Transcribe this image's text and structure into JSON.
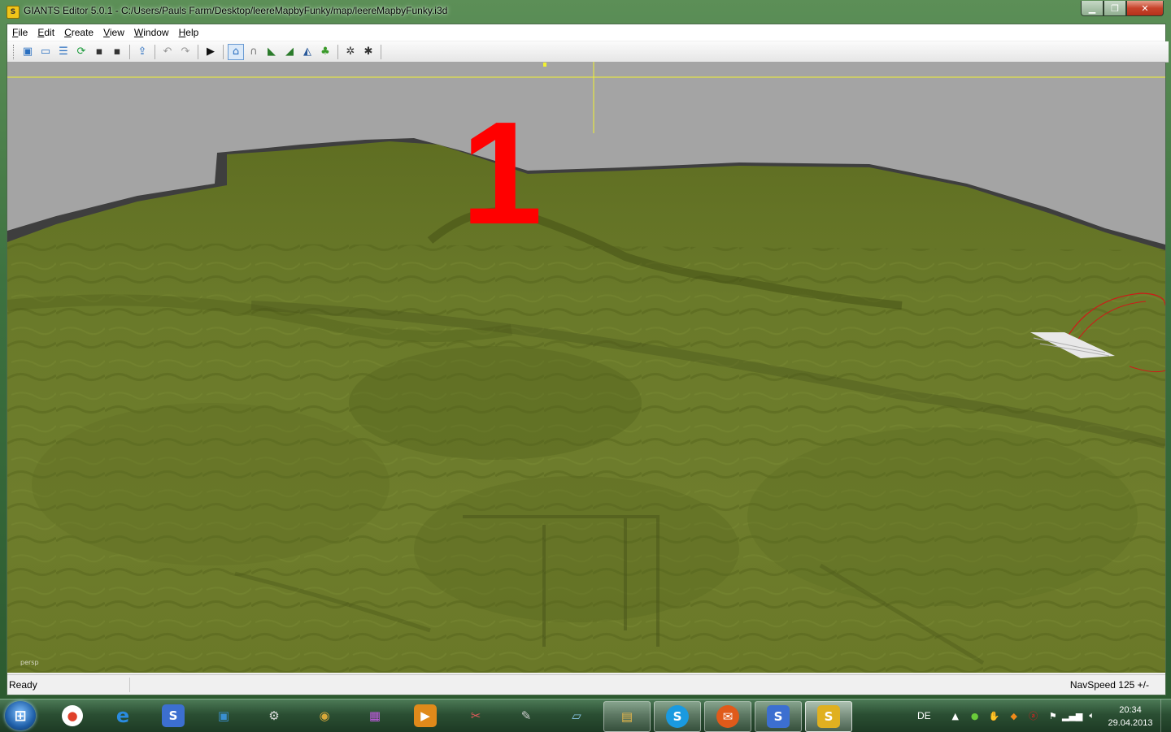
{
  "window": {
    "title": "GIANTS Editor 5.0.1 - C:/Users/Pauls Farm/Desktop/leereMapbyFunky/map/leereMapbyFunky.i3d",
    "app_icon": "S",
    "buttons": {
      "minimize": "minimize-icon",
      "maximize": "maximize-icon",
      "close": "close-icon"
    }
  },
  "menu": {
    "items": [
      {
        "first": "F",
        "rest": "ile"
      },
      {
        "first": "E",
        "rest": "dit"
      },
      {
        "first": "C",
        "rest": "reate"
      },
      {
        "first": "V",
        "rest": "iew"
      },
      {
        "first": "W",
        "rest": "indow"
      },
      {
        "first": "H",
        "rest": "elp"
      }
    ]
  },
  "toolbar": {
    "groups": [
      [
        "new-scene-icon",
        "open-icon",
        "properties-icon",
        "reload-icon",
        "save-icon",
        "save-as-icon"
      ],
      [
        "import-icon"
      ],
      [
        "undo-icon",
        "redo-icon"
      ],
      [
        "play-icon"
      ],
      [
        "select-mode-icon",
        "move-mode-icon",
        "terrain-sculpt-icon",
        "terrain-paint-icon",
        "foliage-paint-icon",
        "grass-paint-icon"
      ],
      [
        "navigate-mode-icon",
        "snap-icon"
      ]
    ]
  },
  "viewport": {
    "overlay_text": "1",
    "camera_label": "persp",
    "colors": {
      "sky": "#a4a4a4",
      "terrain": "#6b7a2a",
      "overlay_text": "#ff0000",
      "guide": "#ffff33"
    }
  },
  "status": {
    "left": "Ready",
    "right": "NavSpeed 125 +/-"
  },
  "taskbar": {
    "start": "windows-start-icon",
    "apps": [
      {
        "name": "chrome-icon",
        "glyph": "●",
        "color": "#e0402a"
      },
      {
        "name": "internet-explorer-icon",
        "glyph": "e",
        "color": "#2a8be0"
      },
      {
        "name": "giants-editor-icon",
        "glyph": "S",
        "color": "#3c6fd0"
      },
      {
        "name": "computer-icon",
        "glyph": "▣",
        "color": "#3a8fd0"
      },
      {
        "name": "settings-icon",
        "glyph": "⚙",
        "color": "#666"
      },
      {
        "name": "dvd-icon",
        "glyph": "◉",
        "color": "#b88a2a"
      },
      {
        "name": "archive-icon",
        "glyph": "▦",
        "color": "#8a3aa8"
      },
      {
        "name": "media-player-icon",
        "glyph": "▶",
        "color": "#e08a1a"
      },
      {
        "name": "snipping-tool-icon",
        "glyph": "✂",
        "color": "#c23a3a"
      },
      {
        "name": "gimp-icon",
        "glyph": "✎",
        "color": "#555"
      },
      {
        "name": "notepad-icon",
        "glyph": "▱",
        "color": "#5aa0c8"
      },
      {
        "name": "explorer-icon",
        "glyph": "▤",
        "color": "#d8a83a"
      },
      {
        "name": "skype-icon",
        "glyph": "S",
        "color": "#1a9ae0"
      },
      {
        "name": "mail-icon",
        "glyph": "✉",
        "color": "#e05a1a"
      },
      {
        "name": "giants-editor-icon-2",
        "glyph": "S",
        "color": "#3c6fd0"
      },
      {
        "name": "giants-editor-active-icon",
        "glyph": "S",
        "color": "#e0b020"
      }
    ],
    "tray": {
      "language": "DE",
      "icons": [
        "show-hidden-icons",
        "evernote-icon",
        "hand-icon",
        "antivirus-icon",
        "avira-icon",
        "action-center-flag-icon",
        "network-icon",
        "volume-icon"
      ],
      "time": "20:34",
      "date": "29.04.2013"
    }
  }
}
